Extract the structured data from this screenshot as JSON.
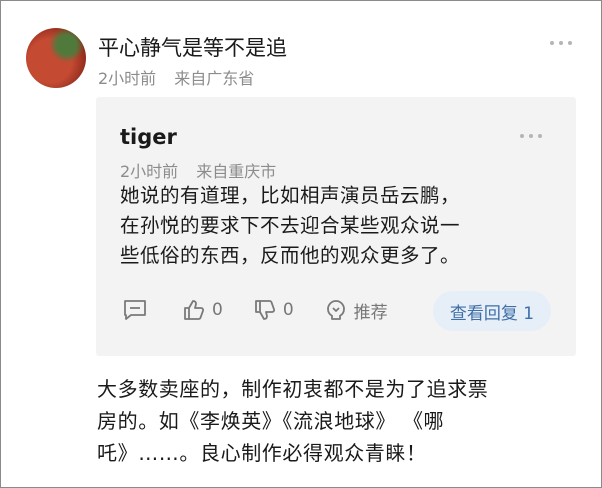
{
  "comment": {
    "username": "平心静气是等不是追",
    "time": "2小时前",
    "location": "来自广东省",
    "text_lines": [
      "大多数卖座的，制作初衷都不是为了追求票",
      "房的。如《李焕英》《流浪地球》 《哪",
      "吒》……。良心制作必得观众青睐！"
    ]
  },
  "reply": {
    "username": "tiger",
    "time": "2小时前",
    "location": "来自重庆市",
    "text_lines": [
      "她说的有道理，比如相声演员岳云鹏，",
      "在孙悦的要求下不去迎合某些观众说一",
      "些低俗的东西，反而他的观众更多了。"
    ],
    "likes": "0",
    "dislikes": "0",
    "recommend_label": "推荐",
    "view_replies_label": "查看回复 1"
  },
  "icons": [
    "avatar",
    "more-icon",
    "comment-icon",
    "thumb-up-icon",
    "thumb-down-icon",
    "recommend-icon"
  ],
  "colors": {
    "link": "#3f6fa8",
    "reply_bg": "#f3f3f3",
    "meta": "#8c8c8c"
  }
}
